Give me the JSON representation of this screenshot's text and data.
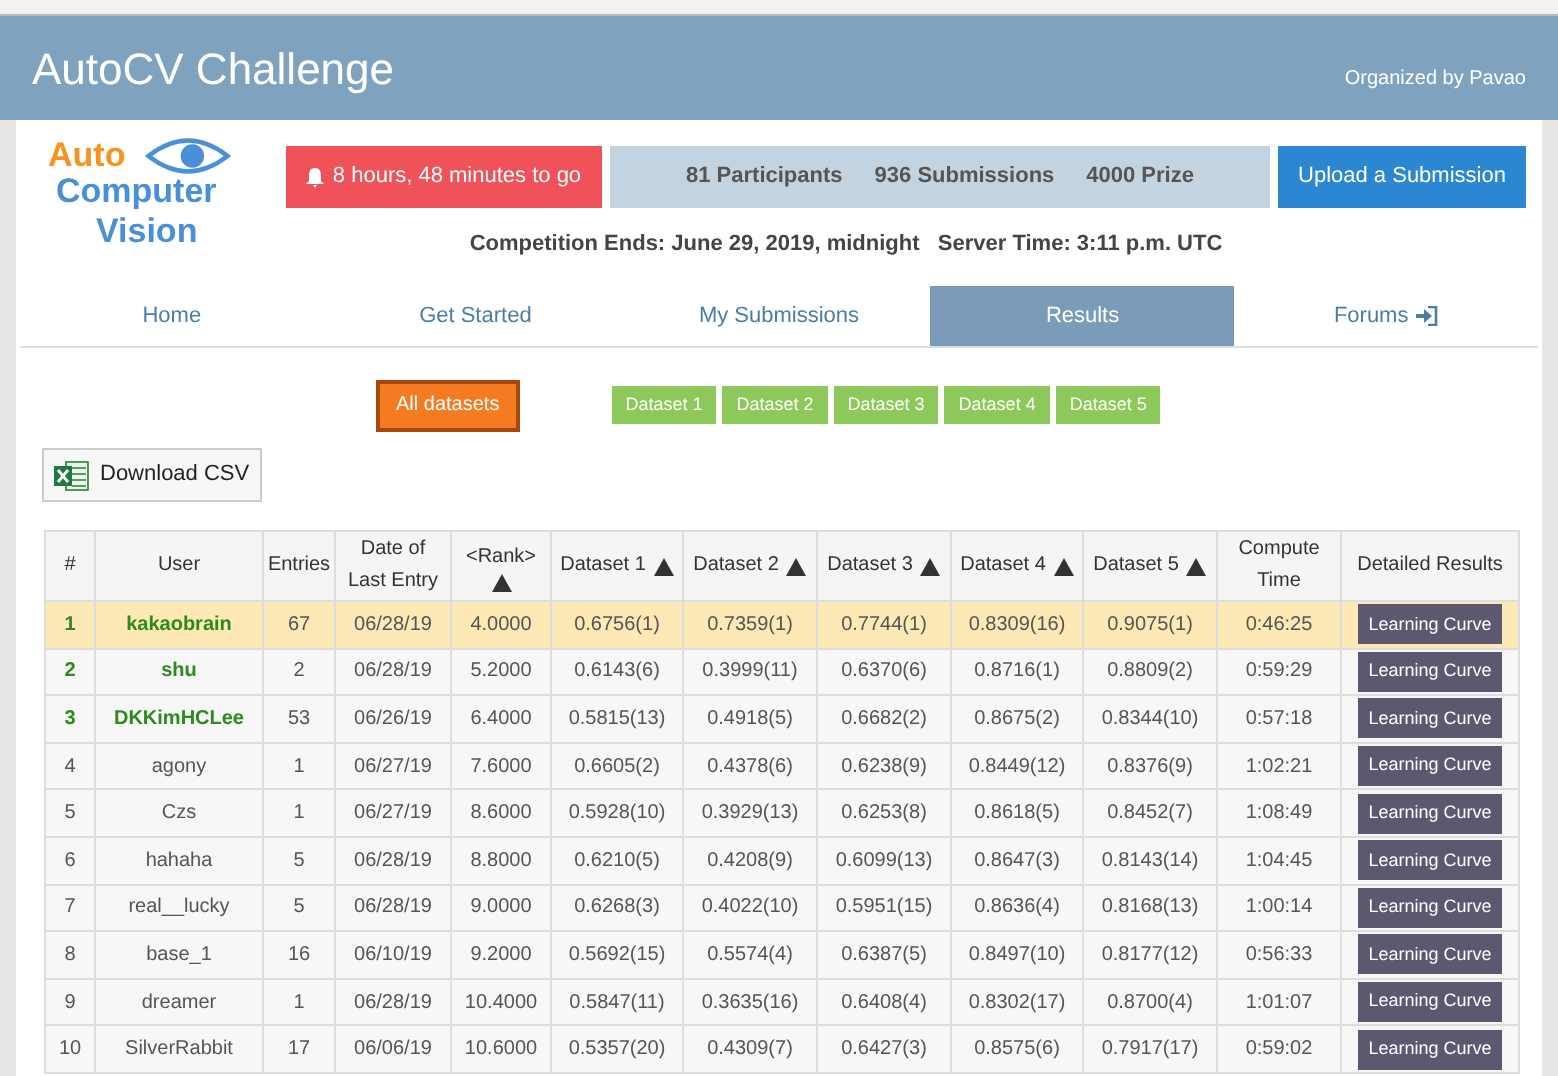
{
  "header": {
    "title": "AutoCV Challenge",
    "organizer": "Organized by Pavao"
  },
  "logo": {
    "line_1": "Auto",
    "line_2": "Computer",
    "line_3": "Vision"
  },
  "countdown": "8 hours, 48 minutes to go",
  "stats": [
    "81 Participants",
    "936 Submissions",
    "4000 Prize"
  ],
  "upload_button": "Upload a Submission",
  "info": "Competition Ends: June 29, 2019, midnight   Server Time: 3:11 p.m. UTC",
  "tabs": [
    {
      "label": "Home",
      "selected": false
    },
    {
      "label": "Get Started",
      "selected": false
    },
    {
      "label": "My Submissions",
      "selected": false
    },
    {
      "label": "Results",
      "selected": true
    },
    {
      "label": "Forums",
      "selected": false,
      "kind": "external"
    }
  ],
  "dataset_filters": [
    {
      "label": "All datasets",
      "selected": true
    },
    {
      "label": "Dataset 1",
      "selected": false
    },
    {
      "label": "Dataset 2",
      "selected": false
    },
    {
      "label": "Dataset 3",
      "selected": false
    },
    {
      "label": "Dataset 4",
      "selected": false
    },
    {
      "label": "Dataset 5",
      "selected": false
    }
  ],
  "download_button": "Download CSV",
  "table": {
    "columns": [
      {
        "label": "#",
        "sort": false
      },
      {
        "label": "User",
        "sort": false
      },
      {
        "label": "Entries",
        "sort": false
      },
      {
        "label": "Date of Last Entry",
        "sort": false
      },
      {
        "label": "<Rank>",
        "sort": true,
        "stacked": true
      },
      {
        "label": "Dataset 1",
        "sort": true
      },
      {
        "label": "Dataset 2",
        "sort": true
      },
      {
        "label": "Dataset 3",
        "sort": true
      },
      {
        "label": "Dataset 4",
        "sort": true
      },
      {
        "label": "Dataset 5",
        "sort": true
      },
      {
        "label": "Compute Time",
        "sort": false
      },
      {
        "label": "Detailed Results",
        "sort": false
      }
    ],
    "rows": [
      {
        "cells": [
          "1",
          "kakaobrain",
          "67",
          "06/28/19",
          "4.0000",
          "0.6756(1)",
          "0.7359(1)",
          "0.7744(1)",
          "0.8309(16)",
          "0.9075(1)",
          "0:46:25"
        ],
        "action": "Learning Curve",
        "highlighted": true,
        "winner": true
      },
      {
        "cells": [
          "2",
          "shu",
          "2",
          "06/28/19",
          "5.2000",
          "0.6143(6)",
          "0.3999(11)",
          "0.6370(6)",
          "0.8716(1)",
          "0.8809(2)",
          "0:59:29"
        ],
        "action": "Learning Curve",
        "highlighted": false,
        "winner": true
      },
      {
        "cells": [
          "3",
          "DKKimHCLee",
          "53",
          "06/26/19",
          "6.4000",
          "0.5815(13)",
          "0.4918(5)",
          "0.6682(2)",
          "0.8675(2)",
          "0.8344(10)",
          "0:57:18"
        ],
        "action": "Learning Curve",
        "highlighted": false,
        "winner": true
      },
      {
        "cells": [
          "4",
          "agony",
          "1",
          "06/27/19",
          "7.6000",
          "0.6605(2)",
          "0.4378(6)",
          "0.6238(9)",
          "0.8449(12)",
          "0.8376(9)",
          "1:02:21"
        ],
        "action": "Learning Curve",
        "highlighted": false,
        "winner": false
      },
      {
        "cells": [
          "5",
          "Czs",
          "1",
          "06/27/19",
          "8.6000",
          "0.5928(10)",
          "0.3929(13)",
          "0.6253(8)",
          "0.8618(5)",
          "0.8452(7)",
          "1:08:49"
        ],
        "action": "Learning Curve",
        "highlighted": false,
        "winner": false
      },
      {
        "cells": [
          "6",
          "hahaha",
          "5",
          "06/28/19",
          "8.8000",
          "0.6210(5)",
          "0.4208(9)",
          "0.6099(13)",
          "0.8647(3)",
          "0.8143(14)",
          "1:04:45"
        ],
        "action": "Learning Curve",
        "highlighted": false,
        "winner": false
      },
      {
        "cells": [
          "7",
          "real__lucky",
          "5",
          "06/28/19",
          "9.0000",
          "0.6268(3)",
          "0.4022(10)",
          "0.5951(15)",
          "0.8636(4)",
          "0.8168(13)",
          "1:00:14"
        ],
        "action": "Learning Curve",
        "highlighted": false,
        "winner": false
      },
      {
        "cells": [
          "8",
          "base_1",
          "16",
          "06/10/19",
          "9.2000",
          "0.5692(15)",
          "0.5574(4)",
          "0.6387(5)",
          "0.8497(10)",
          "0.8177(12)",
          "0:56:33"
        ],
        "action": "Learning Curve",
        "highlighted": false,
        "winner": false
      },
      {
        "cells": [
          "9",
          "dreamer",
          "1",
          "06/28/19",
          "10.4000",
          "0.5847(11)",
          "0.3635(16)",
          "0.6408(4)",
          "0.8302(17)",
          "0.8700(4)",
          "1:01:07"
        ],
        "action": "Learning Curve",
        "highlighted": false,
        "winner": false
      },
      {
        "cells": [
          "10",
          "SilverRabbit",
          "17",
          "06/06/19",
          "10.6000",
          "0.5357(20)",
          "0.4309(7)",
          "0.6427(3)",
          "0.8575(6)",
          "0.7917(17)",
          "0:59:02"
        ],
        "action": "Learning Curve",
        "highlighted": false,
        "winner": false
      }
    ]
  }
}
